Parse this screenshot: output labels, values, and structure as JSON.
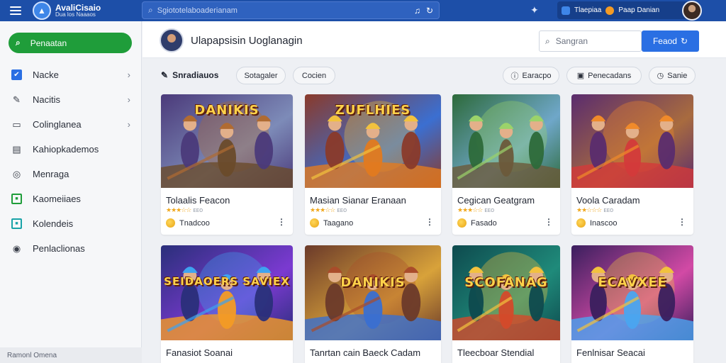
{
  "topbar": {
    "brand_name": "AvaliCisaio",
    "brand_sub": "Dua los Naaaos",
    "search_placeholder": "Sgiototelaboaderianam",
    "pill_left": "Tlaepiaa",
    "pill_right": "Paap Danian"
  },
  "sidebar": {
    "search_label": "Penaatan",
    "items": [
      {
        "label": "Nacke",
        "icon": "checkbox-icon",
        "color": "#2a6fe3",
        "chevron": true
      },
      {
        "label": "Nacitis",
        "icon": "pencil-icon",
        "color": "#3a3f4a",
        "chevron": true
      },
      {
        "label": "Colinglanea",
        "icon": "tablet-icon",
        "color": "#3a3f4a",
        "chevron": true
      },
      {
        "label": "Kahiopkademos",
        "icon": "image-icon",
        "color": "#3a3f4a",
        "chevron": false
      },
      {
        "label": "Menraga",
        "icon": "settings-square-icon",
        "color": "#3a3f4a",
        "chevron": false
      },
      {
        "label": "Kaomeiiaes",
        "icon": "green-square-icon",
        "color": "#1f9d3a",
        "chevron": false
      },
      {
        "label": "Kolendeis",
        "icon": "teal-square-icon",
        "color": "#1aa3a8",
        "chevron": false
      },
      {
        "label": "Penlaclionas",
        "icon": "paint-icon",
        "color": "#3a3f4a",
        "chevron": false
      }
    ],
    "footer": "Ramonl Omena"
  },
  "header": {
    "title": "Ulapapsisin Uoglanagin",
    "search_placeholder": "Sangran",
    "button_label": "Feaod"
  },
  "filters": {
    "label": "Snradiauos",
    "chips": [
      "Sotagaler",
      "Cocien"
    ],
    "right_chips": [
      "Earacpo",
      "Penecadans",
      "Sanie"
    ]
  },
  "cards": [
    {
      "title": "Tolaalis Feacon",
      "rating_text": "ᴇᴇᴏ",
      "stars": 3,
      "coins": "Tnadcoo",
      "art_label": "DANIKIS",
      "palette": [
        "#4b3a7a",
        "#7d8bb8",
        "#6a4b2a",
        "#b06b32"
      ]
    },
    {
      "title": "Masian Sianar Eranaan",
      "rating_text": "ᴇᴇᴏ",
      "stars": 3,
      "coins": "Taagano",
      "art_label": "ZUFLHIES",
      "palette": [
        "#8a3a2a",
        "#3b6fd1",
        "#e27a1f",
        "#f2c23e"
      ]
    },
    {
      "title": "Cegican Geatgram",
      "rating_text": "ᴇᴇᴏ",
      "stars": 3,
      "coins": "Fasado",
      "art_label": "",
      "palette": [
        "#2d6a3a",
        "#6fa7c9",
        "#6b5a3a",
        "#9bd36a"
      ]
    },
    {
      "title": "Voola Caradam",
      "rating_text": "ᴇᴇᴏ",
      "stars": 2,
      "coins": "Inascoo",
      "art_label": "",
      "palette": [
        "#5a2c6e",
        "#a86b3f",
        "#d33a3a",
        "#f08a2a"
      ]
    },
    {
      "title": "Fanasiot Soanai",
      "rating_text": "",
      "stars": 0,
      "coins": "",
      "art_label": "SEIDAOERS SAVIEX",
      "palette": [
        "#2a2f7a",
        "#7b3ad1",
        "#f39b25",
        "#3ea3f0"
      ]
    },
    {
      "title": "Tanrtan cain Baeck Cadam",
      "rating_text": "",
      "stars": 0,
      "coins": "",
      "art_label": "DANIKIS",
      "palette": [
        "#6b3a2a",
        "#d8a23a",
        "#3a6fd1",
        "#a94c2a"
      ]
    },
    {
      "title": "Tleecboar Stendial",
      "rating_text": "",
      "stars": 0,
      "coins": "",
      "art_label": "SCOFANAG",
      "palette": [
        "#0e4a4e",
        "#1f8a7a",
        "#d44a2a",
        "#f2c23e"
      ]
    },
    {
      "title": "Fenlnisar Seacai",
      "rating_text": "",
      "stars": 0,
      "coins": "",
      "art_label": "ECAVXEE",
      "palette": [
        "#3a1f5e",
        "#d24aa5",
        "#4aa5f0",
        "#f2c23e"
      ]
    }
  ]
}
